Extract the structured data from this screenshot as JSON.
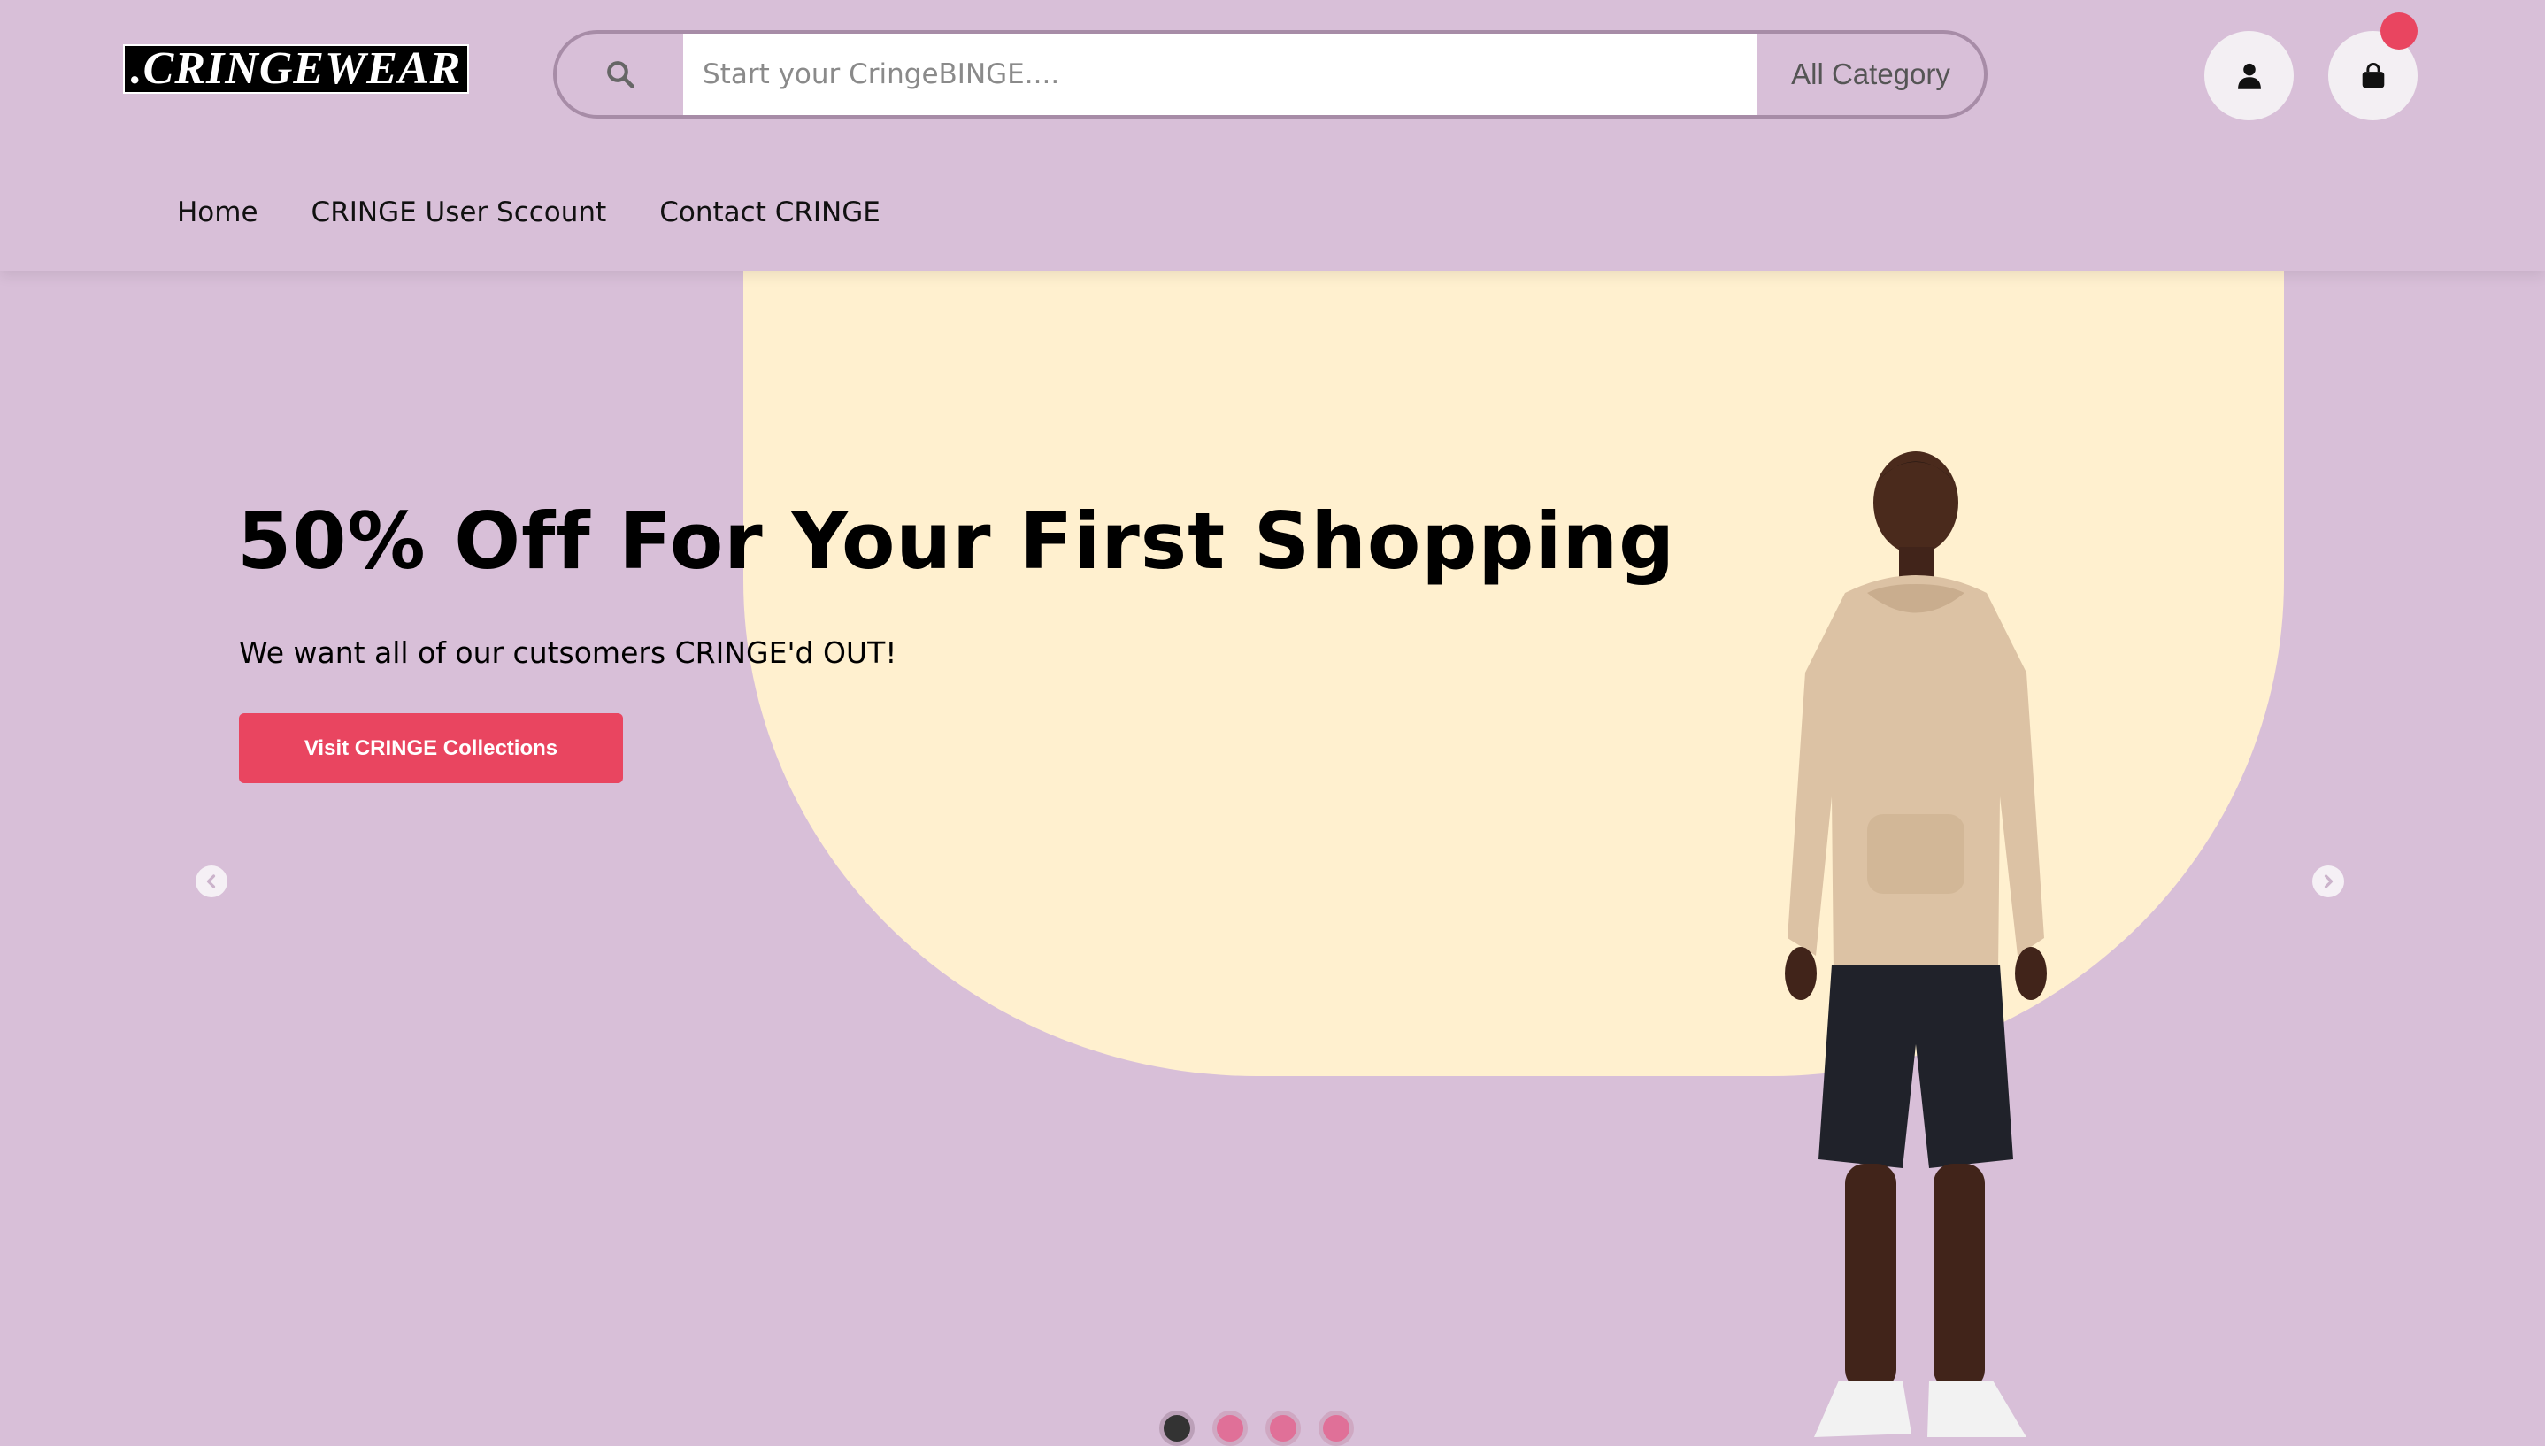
{
  "brand": {
    "logo_text": ".CRINGEWEAR"
  },
  "search": {
    "placeholder": "Start your CringeBINGE....",
    "value": "",
    "category_label": "All Category"
  },
  "header_icons": {
    "user": "user-icon",
    "cart": "shopping-bag-icon",
    "cart_badge_color": "#e94560"
  },
  "nav": {
    "items": [
      {
        "label": "Home"
      },
      {
        "label": "CRINGE User Sccount"
      },
      {
        "label": "Contact CRINGE"
      }
    ]
  },
  "hero": {
    "title": "50% Off For Your First Shopping",
    "subtitle": "We want all of our cutsomers CRINGE'd OUT!",
    "cta_label": "Visit CRINGE Collections",
    "accent_color": "#e94560",
    "shape_color": "#fff0cf",
    "background_color": "#d8bfd8"
  },
  "carousel": {
    "prev_icon": "chevron-left-icon",
    "next_icon": "chevron-right-icon",
    "slides": 4,
    "active_index": 0
  }
}
